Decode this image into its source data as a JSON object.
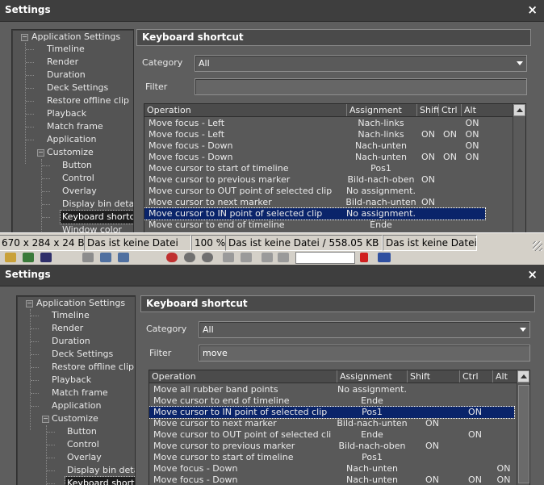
{
  "window1": {
    "title": "Settings",
    "close": "×",
    "tree": [
      "Application Settings",
      "Timeline",
      "Render",
      "Duration",
      "Deck Settings",
      "Restore offline clip",
      "Playback",
      "Match frame",
      "Application",
      "Customize",
      "Button",
      "Control",
      "Overlay",
      "Display bin details",
      "Keyboard shortcut",
      "Window color"
    ],
    "panel_title": "Keyboard shortcut",
    "category_label": "Category",
    "category_value": "All",
    "filter_label": "Filter",
    "filter_value": "",
    "columns": [
      "Operation",
      "Assignment",
      "Shift",
      "Ctrl",
      "Alt"
    ],
    "rows": [
      {
        "op": "Move focus - Left",
        "as": "Nach-links",
        "shift": "",
        "ctrl": "",
        "alt": "ON"
      },
      {
        "op": "Move focus - Left",
        "as": "Nach-links",
        "shift": "ON",
        "ctrl": "ON",
        "alt": "ON"
      },
      {
        "op": "Move focus - Down",
        "as": "Nach-unten",
        "shift": "",
        "ctrl": "",
        "alt": "ON"
      },
      {
        "op": "Move focus - Down",
        "as": "Nach-unten",
        "shift": "ON",
        "ctrl": "ON",
        "alt": "ON"
      },
      {
        "op": "Move cursor to start of timeline",
        "as": "Pos1",
        "shift": "",
        "ctrl": "",
        "alt": ""
      },
      {
        "op": "Move cursor to previous marker",
        "as": "Bild-nach-oben",
        "shift": "ON",
        "ctrl": "",
        "alt": ""
      },
      {
        "op": "Move cursor to OUT point of selected clip",
        "as": "No assignment.",
        "shift": "",
        "ctrl": "",
        "alt": ""
      },
      {
        "op": "Move cursor to next marker",
        "as": "Bild-nach-unten",
        "shift": "ON",
        "ctrl": "",
        "alt": ""
      },
      {
        "op": "Move cursor to IN point of selected clip",
        "as": "No assignment.",
        "shift": "",
        "ctrl": "",
        "alt": ""
      },
      {
        "op": "Move cursor to end of timeline",
        "as": "Ende",
        "shift": "",
        "ctrl": "",
        "alt": ""
      }
    ]
  },
  "statusbar": {
    "dims": "670 x 284 x 24 BP",
    "file": "Das ist keine Datei",
    "zoom": "100 %",
    "fileinfo": "Das ist keine Datei / 558.05 KB",
    "file2": "Das ist keine Datei"
  },
  "window2": {
    "title": "Settings",
    "close": "×",
    "tree": [
      "Application Settings",
      "Timeline",
      "Render",
      "Duration",
      "Deck Settings",
      "Restore offline clip",
      "Playback",
      "Match frame",
      "Application",
      "Customize",
      "Button",
      "Control",
      "Overlay",
      "Display bin details",
      "Keyboard shortcut"
    ],
    "panel_title": "Keyboard shortcut",
    "category_label": "Category",
    "category_value": "All",
    "filter_label": "Filter",
    "filter_value": "move",
    "columns": [
      "Operation",
      "Assignment",
      "Shift",
      "Ctrl",
      "Alt"
    ],
    "rows": [
      {
        "op": "Move all rubber band points",
        "as": "No assignment.",
        "shift": "",
        "ctrl": "",
        "alt": ""
      },
      {
        "op": "Move cursor to end of timeline",
        "as": "Ende",
        "shift": "",
        "ctrl": "",
        "alt": ""
      },
      {
        "op": "Move cursor to IN point of selected clip",
        "as": "Pos1",
        "shift": "",
        "ctrl": "ON",
        "alt": ""
      },
      {
        "op": "Move cursor to next marker",
        "as": "Bild-nach-unten",
        "shift": "ON",
        "ctrl": "",
        "alt": ""
      },
      {
        "op": "Move cursor to OUT point of selected clip",
        "as": "Ende",
        "shift": "",
        "ctrl": "ON",
        "alt": ""
      },
      {
        "op": "Move cursor to previous marker",
        "as": "Bild-nach-oben",
        "shift": "ON",
        "ctrl": "",
        "alt": ""
      },
      {
        "op": "Move cursor to start of timeline",
        "as": "Pos1",
        "shift": "",
        "ctrl": "",
        "alt": ""
      },
      {
        "op": "Move focus - Down",
        "as": "Nach-unten",
        "shift": "",
        "ctrl": "",
        "alt": "ON"
      },
      {
        "op": "Move focus - Down",
        "as": "Nach-unten",
        "shift": "ON",
        "ctrl": "ON",
        "alt": "ON"
      }
    ]
  }
}
